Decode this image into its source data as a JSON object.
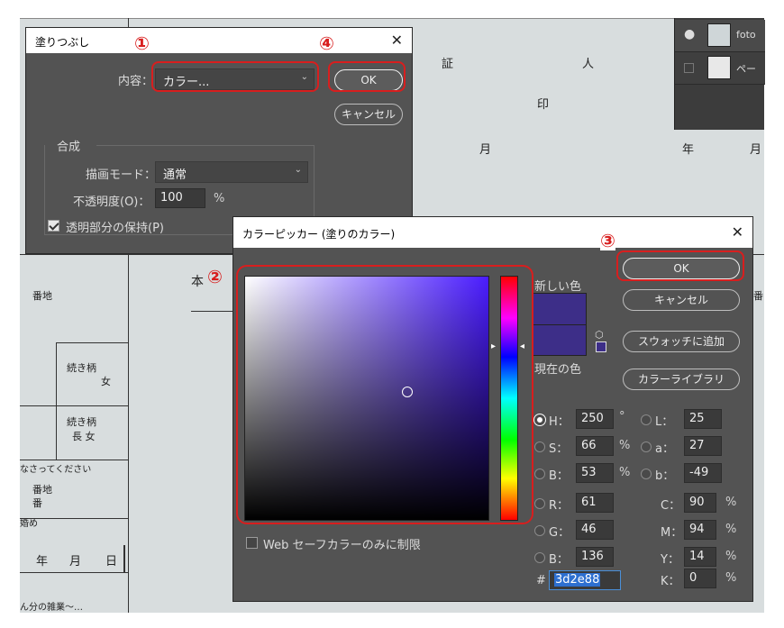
{
  "background_doc": {
    "texts": [
      "証",
      "人",
      "印",
      "月",
      "年",
      "月",
      "本",
      "番地",
      "番",
      "続き柄",
      "女",
      "続き柄",
      "長 女",
      "なさってください",
      "番地",
      "番",
      "婚め",
      "年",
      "月",
      "日",
      "ん分の雑業～…"
    ]
  },
  "layers_panel": {
    "rows": [
      {
        "label": "foto",
        "visible": true
      },
      {
        "label": "ペー",
        "visible": false
      }
    ]
  },
  "fill_dialog": {
    "title": "塗りつぶし",
    "content_label": "内容：",
    "content_value": "カラー...",
    "ok": "OK",
    "cancel": "キャンセル",
    "composite_header": "合成",
    "mode_label": "描画モード：",
    "mode_value": "通常",
    "opacity_label": "不透明度(O)：",
    "opacity_value": "100",
    "opacity_unit": "%",
    "preserve_label": "透明部分の保持(P)",
    "preserve_checked": true
  },
  "color_picker": {
    "title": "カラーピッカー (塗りのカラー)",
    "new_label": "新しい色",
    "current_label": "現在の色",
    "new_color": "#3d2e88",
    "current_color": "#3d2e88",
    "ok": "OK",
    "cancel": "キャンセル",
    "add_swatch": "スウォッチに追加",
    "color_libraries": "カラーライブラリ",
    "web_safe_label": "Web セーフカラーのみに制限",
    "H": {
      "label": "H：",
      "value": "250",
      "unit": "°"
    },
    "S": {
      "label": "S：",
      "value": "66",
      "unit": "%"
    },
    "Bv": {
      "label": "B：",
      "value": "53",
      "unit": "%"
    },
    "R": {
      "label": "R：",
      "value": "61"
    },
    "G": {
      "label": "G：",
      "value": "46"
    },
    "Bc": {
      "label": "B：",
      "value": "136"
    },
    "L": {
      "label": "L：",
      "value": "25"
    },
    "a": {
      "label": "a：",
      "value": "27"
    },
    "b": {
      "label": "b：",
      "value": "-49"
    },
    "C": {
      "label": "C：",
      "value": "90",
      "unit": "%"
    },
    "M": {
      "label": "M：",
      "value": "94",
      "unit": "%"
    },
    "Y": {
      "label": "Y：",
      "value": "14",
      "unit": "%"
    },
    "K": {
      "label": "K：",
      "value": "0",
      "unit": "%"
    },
    "hex_label": "#",
    "hex_value": "3d2e88",
    "hue_color": "#4a1cff"
  },
  "annotations": {
    "n1": "①",
    "n2": "②",
    "n3": "③",
    "n4": "④",
    "highlight_color": "#d81e1e"
  }
}
